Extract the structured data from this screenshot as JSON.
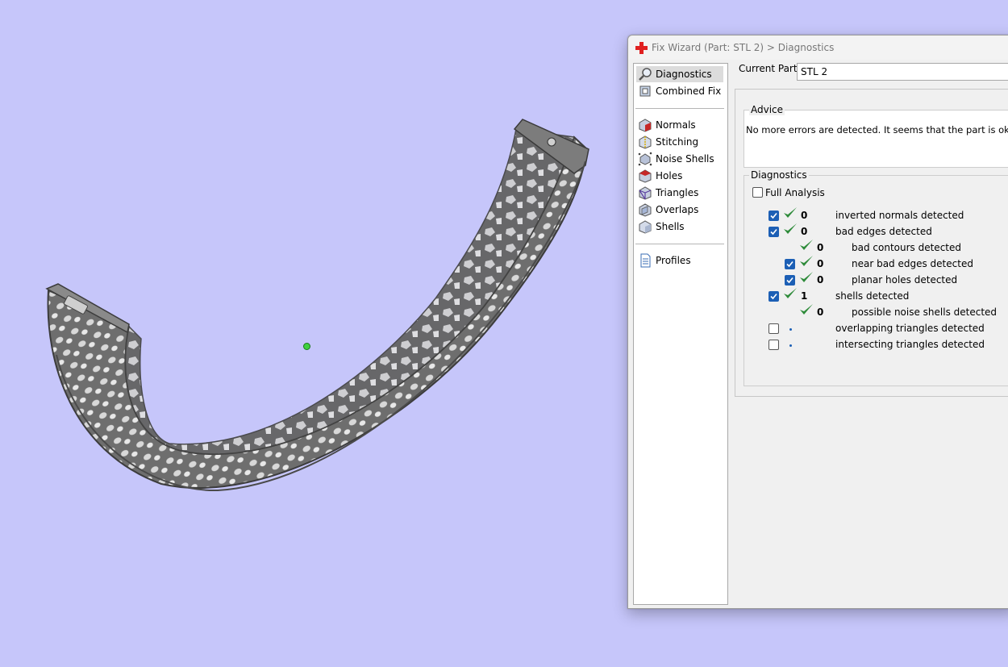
{
  "window": {
    "title": "Fix Wizard (Part: STL 2) > Diagnostics"
  },
  "sidebar": {
    "top_items": [
      {
        "label": "Diagnostics",
        "icon": "magnifier-icon",
        "selected": true
      },
      {
        "label": "Combined Fix",
        "icon": "combined-fix-icon"
      }
    ],
    "tool_items": [
      {
        "label": "Normals",
        "icon": "normals-cube-icon"
      },
      {
        "label": "Stitching",
        "icon": "stitching-cube-icon"
      },
      {
        "label": "Noise Shells",
        "icon": "noise-shells-icon"
      },
      {
        "label": "Holes",
        "icon": "holes-cube-icon"
      },
      {
        "label": "Triangles",
        "icon": "triangles-cube-icon"
      },
      {
        "label": "Overlaps",
        "icon": "overlaps-cube-icon"
      },
      {
        "label": "Shells",
        "icon": "shells-cube-icon"
      }
    ],
    "bottom_items": [
      {
        "label": "Profiles",
        "icon": "document-icon"
      }
    ]
  },
  "current_part": {
    "label": "Current Part:",
    "value": "STL 2"
  },
  "advice": {
    "title": "Advice",
    "text": "No more errors are detected. It seems that the part is ok. Note the"
  },
  "diagnostics": {
    "title": "Diagnostics",
    "full_analysis": {
      "label": "Full Analysis",
      "checked": false
    },
    "rows": [
      {
        "checkbox": true,
        "checked": true,
        "status": "ok",
        "count": "0",
        "label": "inverted normals detected",
        "indent": 0
      },
      {
        "checkbox": true,
        "checked": true,
        "status": "ok",
        "count": "0",
        "label": "bad edges detected",
        "indent": 0
      },
      {
        "checkbox": false,
        "checked": false,
        "status": "ok",
        "count": "0",
        "label": "bad contours detected",
        "indent": 1
      },
      {
        "checkbox": true,
        "checked": true,
        "status": "ok",
        "count": "0",
        "label": "near bad edges detected",
        "indent": 1
      },
      {
        "checkbox": true,
        "checked": true,
        "status": "ok",
        "count": "0",
        "label": "planar holes detected",
        "indent": 1
      },
      {
        "checkbox": true,
        "checked": true,
        "status": "ok",
        "count": "1",
        "label": "shells detected",
        "indent": 0
      },
      {
        "checkbox": false,
        "checked": false,
        "status": "ok",
        "count": "0",
        "label": "possible noise shells detected",
        "indent": 1
      },
      {
        "checkbox": true,
        "checked": false,
        "status": "pending",
        "count": "",
        "label": "overlapping triangles detected",
        "indent": 0
      },
      {
        "checkbox": true,
        "checked": false,
        "status": "pending",
        "count": "",
        "label": "intersecting triangles detected",
        "indent": 0
      }
    ]
  },
  "colors": {
    "viewport_background": "#c6c6fa",
    "model": "#7a7a7a",
    "check_green": "#2e8b3a",
    "checkbox_blue": "#1c5fb5",
    "title_icon_red": "#e02020"
  }
}
